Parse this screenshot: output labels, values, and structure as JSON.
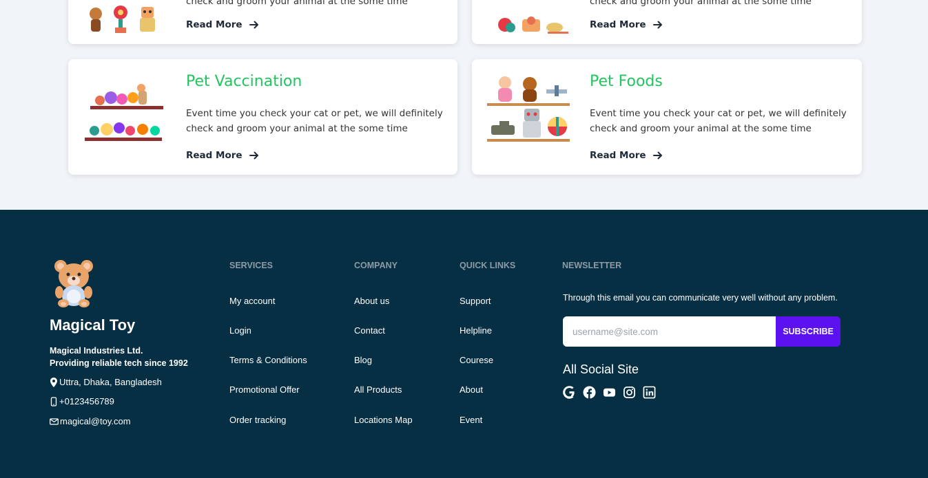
{
  "cards": {
    "top_left": {
      "desc_partial": "check and groom your animal at the some time",
      "read_more": "Read More"
    },
    "top_right": {
      "desc_partial": "check and groom your animal at the some time",
      "read_more": "Read More"
    },
    "vaccination": {
      "title": "Pet Vaccination",
      "desc": "Event time you check your cat or pet, we will definitely check and groom your animal at the some time",
      "read_more": "Read More"
    },
    "foods": {
      "title": "Pet Foods",
      "desc": "Event time you check your cat or pet, we will definitely check and groom your animal at the some time",
      "read_more": "Read More"
    }
  },
  "footer": {
    "brand": {
      "name": "Magical Toy",
      "company": "Magical Industries Ltd.",
      "tagline": "Providing reliable tech since 1992",
      "address": "Uttra, Dhaka, Bangladesh",
      "phone": "+0123456789",
      "email": "magical@toy.com"
    },
    "services": {
      "heading": "SERVICES",
      "links": [
        "My account",
        "Login",
        "Terms & Conditions",
        "Promotional Offer",
        "Order tracking"
      ]
    },
    "company": {
      "heading": "COMPANY",
      "links": [
        "About us",
        "Contact",
        "Blog",
        "All Products",
        "Locations Map"
      ]
    },
    "quick_links": {
      "heading": "QUICK LINKS",
      "links": [
        "Support",
        "Helpline",
        "Courese",
        "About",
        "Event"
      ]
    },
    "newsletter": {
      "heading": "NEWSLETTER",
      "text": "Through this email you can communicate very well without any problem.",
      "placeholder": "username@site.com",
      "button": "SUBSCRIBE",
      "social_title": "All Social Site",
      "socials": [
        "google-icon",
        "facebook-icon",
        "youtube-icon",
        "instagram-icon",
        "linkedin-icon"
      ]
    }
  },
  "colors": {
    "accent_green": "#22c55e",
    "footer_bg": "#072f43",
    "button_purple": "#5b11f0"
  }
}
